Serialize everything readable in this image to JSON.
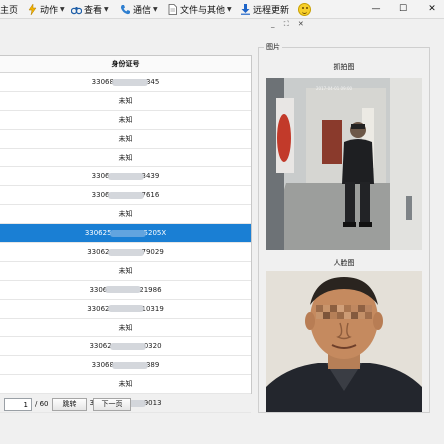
{
  "toolbar": {
    "items": [
      {
        "label": "主页"
      },
      {
        "label": "动作"
      },
      {
        "label": "查看"
      },
      {
        "label": "通信"
      },
      {
        "label": "文件与其他"
      },
      {
        "label": "远程更新"
      }
    ]
  },
  "window": {
    "min": "—",
    "max": "☐",
    "close": "✕"
  },
  "subwindow": {
    "min": "_",
    "max": "⛶",
    "close": "✕"
  },
  "table": {
    "header": "身份证号",
    "rows": [
      {
        "pre": "33068",
        "post": "345",
        "selected": false
      },
      {
        "text": "未知",
        "selected": false
      },
      {
        "text": "未知",
        "selected": false
      },
      {
        "text": "未知",
        "selected": false
      },
      {
        "text": "未知",
        "selected": false
      },
      {
        "pre": "3306",
        "post": "3439",
        "selected": false
      },
      {
        "pre": "3306",
        "post": "7616",
        "selected": false
      },
      {
        "text": "未知",
        "selected": false
      },
      {
        "pre": "330625",
        "post": "5205X",
        "selected": true
      },
      {
        "pre": "33062",
        "post": "79029",
        "selected": false
      },
      {
        "text": "未知",
        "selected": false
      },
      {
        "pre": "3306",
        "post": "21986",
        "selected": false
      },
      {
        "pre": "33062",
        "post": "10319",
        "selected": false
      },
      {
        "text": "未知",
        "selected": false
      },
      {
        "pre": "33062",
        "post": "0320",
        "selected": false
      },
      {
        "pre": "33068",
        "post": "389",
        "selected": false
      },
      {
        "text": "未知",
        "selected": false
      },
      {
        "pre": "33068",
        "post": "9013",
        "selected": false
      }
    ]
  },
  "pager": {
    "current": "1",
    "total": "/ 60",
    "jump_label": "跳转",
    "next_label": "下一页"
  },
  "photo_panel": {
    "group_title": "图片",
    "snap_caption": "抓拍图",
    "face_caption": "人脸图"
  }
}
